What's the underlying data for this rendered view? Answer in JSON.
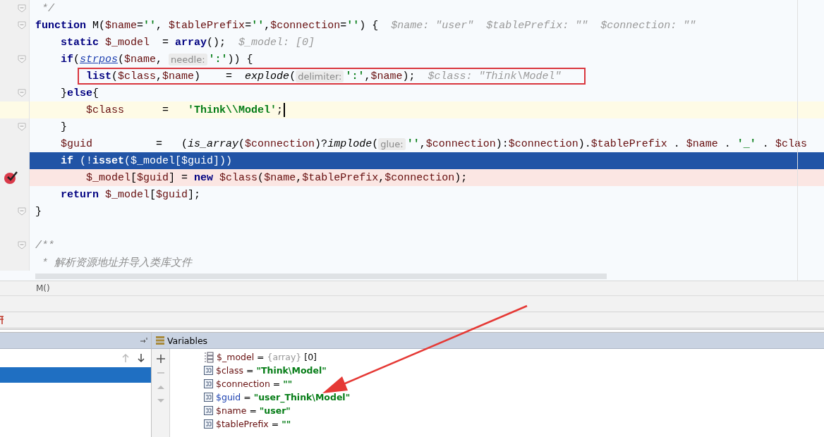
{
  "editor": {
    "lines": [
      {
        "current": false,
        "breakpoint": false,
        "caret": false,
        "fold": true,
        "boxed": false,
        "tokens": [
          {
            "kind": "comment",
            "text": " */"
          }
        ]
      },
      {
        "current": false,
        "breakpoint": false,
        "caret": false,
        "fold": true,
        "boxed": false,
        "tokens": [
          {
            "kind": "keyword",
            "text": "function"
          },
          {
            "kind": "plain",
            "text": " M("
          },
          {
            "kind": "var",
            "text": "$name"
          },
          {
            "kind": "plain",
            "text": "="
          },
          {
            "kind": "string",
            "text": "''"
          },
          {
            "kind": "plain",
            "text": ", "
          },
          {
            "kind": "var",
            "text": "$tablePrefix"
          },
          {
            "kind": "plain",
            "text": "="
          },
          {
            "kind": "string",
            "text": "''"
          },
          {
            "kind": "plain",
            "text": ","
          },
          {
            "kind": "var",
            "text": "$connection"
          },
          {
            "kind": "plain",
            "text": "="
          },
          {
            "kind": "string",
            "text": "''"
          },
          {
            "kind": "plain",
            "text": ") {"
          },
          {
            "kind": "value",
            "text": "$name: \"user\""
          },
          {
            "kind": "value",
            "text": "$tablePrefix: \"\""
          },
          {
            "kind": "value",
            "text": "$connection: \"\""
          }
        ]
      },
      {
        "current": false,
        "breakpoint": false,
        "caret": false,
        "fold": false,
        "boxed": false,
        "tokens": [
          {
            "kind": "keyword",
            "text": "    static "
          },
          {
            "kind": "var",
            "text": "$_model"
          },
          {
            "kind": "plain",
            "text": "  = "
          },
          {
            "kind": "keyword",
            "text": "array"
          },
          {
            "kind": "plain",
            "text": "();"
          },
          {
            "kind": "value",
            "text": "$_model: [0]"
          }
        ]
      },
      {
        "current": false,
        "breakpoint": false,
        "caret": false,
        "fold": true,
        "boxed": false,
        "tokens": [
          {
            "kind": "keyword",
            "text": "    if"
          },
          {
            "kind": "plain",
            "text": "("
          },
          {
            "kind": "link",
            "text": "strpos"
          },
          {
            "kind": "plain",
            "text": "("
          },
          {
            "kind": "var",
            "text": "$name"
          },
          {
            "kind": "plain",
            "text": ", "
          },
          {
            "kind": "hint",
            "text": "needle:"
          },
          {
            "kind": "string",
            "text": "':'"
          },
          {
            "kind": "plain",
            "text": ")) {"
          }
        ]
      },
      {
        "current": false,
        "breakpoint": false,
        "caret": false,
        "fold": false,
        "boxed": true,
        "tokens": [
          {
            "kind": "keyword",
            "text": "        list"
          },
          {
            "kind": "plain",
            "text": "("
          },
          {
            "kind": "var",
            "text": "$class"
          },
          {
            "kind": "plain",
            "text": ","
          },
          {
            "kind": "var",
            "text": "$name"
          },
          {
            "kind": "plain",
            "text": ")    =  "
          },
          {
            "kind": "func",
            "text": "explode"
          },
          {
            "kind": "plain",
            "text": "("
          },
          {
            "kind": "hint",
            "text": "delimiter:"
          },
          {
            "kind": "string",
            "text": "':'"
          },
          {
            "kind": "plain",
            "text": ","
          },
          {
            "kind": "var",
            "text": "$name"
          },
          {
            "kind": "plain",
            "text": ");"
          },
          {
            "kind": "value",
            "text": "$class: \"Think\\Model\""
          }
        ]
      },
      {
        "current": false,
        "breakpoint": false,
        "caret": false,
        "fold": true,
        "boxed": false,
        "tokens": [
          {
            "kind": "plain",
            "text": "    }"
          },
          {
            "kind": "keyword",
            "text": "else"
          },
          {
            "kind": "plain",
            "text": "{"
          }
        ]
      },
      {
        "current": false,
        "breakpoint": false,
        "caret": true,
        "fold": false,
        "boxed": false,
        "tokens": [
          {
            "kind": "var",
            "text": "        $class"
          },
          {
            "kind": "plain",
            "text": "      =   "
          },
          {
            "kind": "string",
            "text": "'Think\\\\Model'"
          },
          {
            "kind": "plain",
            "text": ";"
          }
        ]
      },
      {
        "current": false,
        "breakpoint": false,
        "caret": false,
        "fold": true,
        "boxed": false,
        "tokens": [
          {
            "kind": "plain",
            "text": "    }"
          }
        ]
      },
      {
        "current": false,
        "breakpoint": false,
        "caret": false,
        "fold": false,
        "boxed": false,
        "tokens": [
          {
            "kind": "var",
            "text": "    $guid"
          },
          {
            "kind": "plain",
            "text": "          =   ("
          },
          {
            "kind": "func",
            "text": "is_array"
          },
          {
            "kind": "plain",
            "text": "("
          },
          {
            "kind": "var",
            "text": "$connection"
          },
          {
            "kind": "plain",
            "text": ")?"
          },
          {
            "kind": "func",
            "text": "implode"
          },
          {
            "kind": "plain",
            "text": "("
          },
          {
            "kind": "hint",
            "text": "glue:"
          },
          {
            "kind": "string",
            "text": "''"
          },
          {
            "kind": "plain",
            "text": ","
          },
          {
            "kind": "var",
            "text": "$connection"
          },
          {
            "kind": "plain",
            "text": "):"
          },
          {
            "kind": "var",
            "text": "$connection"
          },
          {
            "kind": "plain",
            "text": ")."
          },
          {
            "kind": "var",
            "text": "$tablePrefix"
          },
          {
            "kind": "plain",
            "text": " . "
          },
          {
            "kind": "var",
            "text": "$name"
          },
          {
            "kind": "plain",
            "text": " . "
          },
          {
            "kind": "string",
            "text": "'_'"
          },
          {
            "kind": "plain",
            "text": " . "
          },
          {
            "kind": "var",
            "text": "$clas"
          }
        ]
      },
      {
        "current": true,
        "breakpoint": false,
        "caret": false,
        "fold": false,
        "boxed": false,
        "tokens": [
          {
            "kind": "keyword",
            "text": "    if"
          },
          {
            "kind": "plain",
            "text": " (!"
          },
          {
            "kind": "keyword",
            "text": "isset"
          },
          {
            "kind": "plain",
            "text": "("
          },
          {
            "kind": "var",
            "text": "$_model"
          },
          {
            "kind": "plain",
            "text": "["
          },
          {
            "kind": "var",
            "text": "$guid"
          },
          {
            "kind": "plain",
            "text": "]))"
          }
        ]
      },
      {
        "current": false,
        "breakpoint": true,
        "caret": false,
        "fold": false,
        "boxed": false,
        "tokens": [
          {
            "kind": "var",
            "text": "        $_model"
          },
          {
            "kind": "plain",
            "text": "["
          },
          {
            "kind": "var",
            "text": "$guid"
          },
          {
            "kind": "plain",
            "text": "] = "
          },
          {
            "kind": "keyword",
            "text": "new "
          },
          {
            "kind": "var",
            "text": "$class"
          },
          {
            "kind": "plain",
            "text": "("
          },
          {
            "kind": "var",
            "text": "$name"
          },
          {
            "kind": "plain",
            "text": ","
          },
          {
            "kind": "var",
            "text": "$tablePrefix"
          },
          {
            "kind": "plain",
            "text": ","
          },
          {
            "kind": "var",
            "text": "$connection"
          },
          {
            "kind": "plain",
            "text": ");"
          }
        ]
      },
      {
        "current": false,
        "breakpoint": false,
        "caret": false,
        "fold": false,
        "boxed": false,
        "tokens": [
          {
            "kind": "keyword",
            "text": "    return "
          },
          {
            "kind": "var",
            "text": "$_model"
          },
          {
            "kind": "plain",
            "text": "["
          },
          {
            "kind": "var",
            "text": "$guid"
          },
          {
            "kind": "plain",
            "text": "];"
          }
        ]
      },
      {
        "current": false,
        "breakpoint": false,
        "caret": false,
        "fold": true,
        "boxed": false,
        "tokens": [
          {
            "kind": "plain",
            "text": "}"
          }
        ]
      },
      {
        "current": false,
        "breakpoint": false,
        "caret": false,
        "fold": false,
        "boxed": false
      },
      {
        "current": false,
        "breakpoint": false,
        "caret": false,
        "fold": true,
        "boxed": false,
        "tokens": [
          {
            "kind": "comment",
            "text": "/**"
          }
        ]
      },
      {
        "current": false,
        "breakpoint": false,
        "caret": false,
        "fold": false,
        "boxed": false,
        "tokens": [
          {
            "kind": "comment",
            "text": " * 解析资源地址并导入类库文件"
          }
        ]
      }
    ]
  },
  "breadcrumb": "M()",
  "debugger": {
    "frames": [
      {
        "selected": true
      }
    ],
    "variables_title": "Variables",
    "variables": [
      {
        "kind": "array",
        "name": "$_model",
        "operator": "=",
        "type": "{array}",
        "value": "[0]",
        "changed": false
      },
      {
        "kind": "string",
        "name": "$class",
        "operator": "=",
        "value": "\"Think\\Model\"",
        "changed": false
      },
      {
        "kind": "string",
        "name": "$connection",
        "operator": "=",
        "value": "\"\"",
        "changed": false
      },
      {
        "kind": "string",
        "name": "$guid",
        "operator": "=",
        "value": "\"user_Think\\Model\"",
        "changed": true
      },
      {
        "kind": "string",
        "name": "$name",
        "operator": "=",
        "value": "\"user\"",
        "changed": false
      },
      {
        "kind": "string",
        "name": "$tablePrefix",
        "operator": "=",
        "value": "\"\"",
        "changed": false
      }
    ]
  }
}
